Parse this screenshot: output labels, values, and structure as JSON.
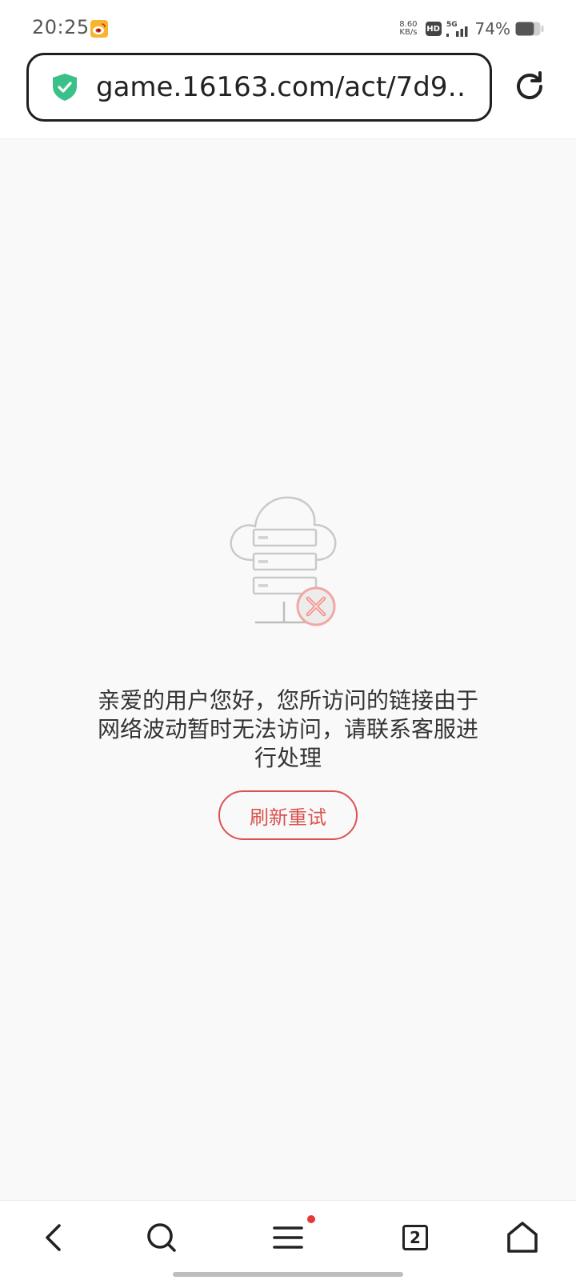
{
  "status_bar": {
    "time": "20:25",
    "net_speed_value": "8.60",
    "net_speed_unit": "KB/s",
    "hd_label": "HD",
    "network_type": "5G",
    "battery_percent": "74%",
    "battery_level": 0.74,
    "notification_icon": "weibo-icon"
  },
  "address_bar": {
    "url": "game.16163.com/act/7d9…",
    "secure_icon": "shield-check-icon",
    "reload_icon": "reload-icon",
    "accent_color": "#3cc08a"
  },
  "error_page": {
    "illustration": "server-cloud-error-icon",
    "message": "亲爱的用户您好，您所访问的链接由于网络波动暂时无法访问，请联系客服进行处理",
    "retry_label": "刷新重试",
    "accent_color": "#d9534f"
  },
  "bottom_nav": {
    "tab_count": "2",
    "has_menu_notification": true,
    "items": [
      "back-icon",
      "search-icon",
      "menu-icon",
      "tabs-icon",
      "home-icon"
    ]
  }
}
